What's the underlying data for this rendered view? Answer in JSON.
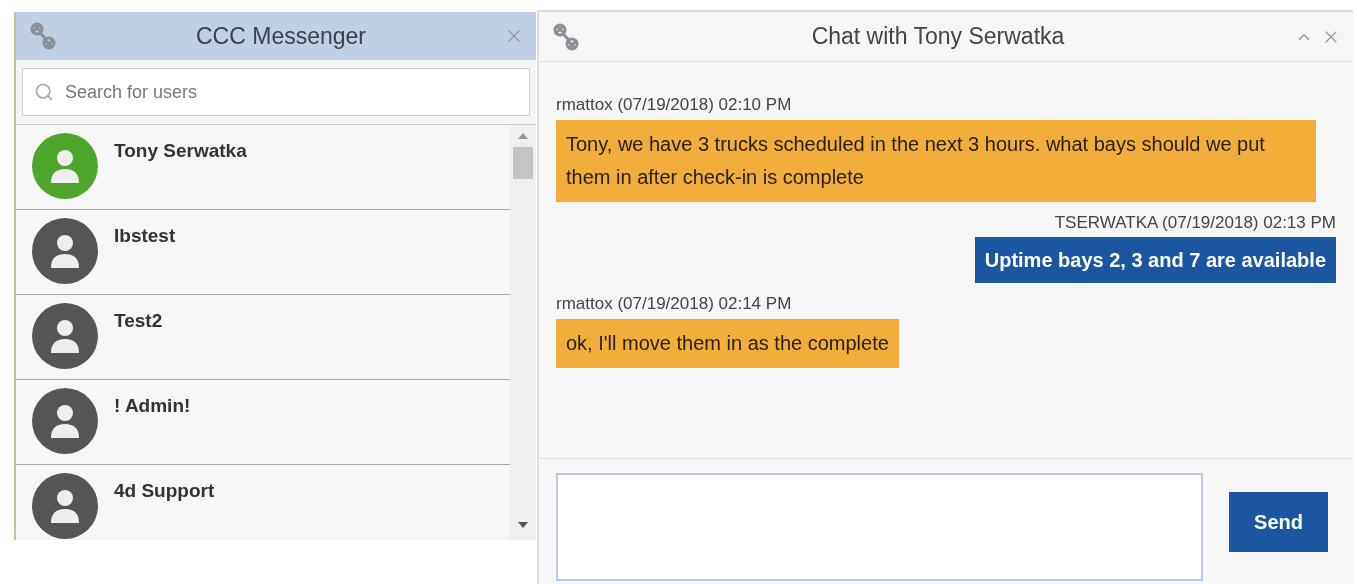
{
  "messenger": {
    "title": "CCC Messenger",
    "search": {
      "placeholder": "Search for users"
    },
    "contacts": [
      {
        "name": "Tony Serwatka",
        "online": true
      },
      {
        "name": "Ibstest",
        "online": false
      },
      {
        "name": "Test2",
        "online": false
      },
      {
        "name": "! Admin!",
        "online": false
      },
      {
        "name": "4d Support",
        "online": false
      }
    ]
  },
  "chat": {
    "title": "Chat with Tony Serwatka",
    "messages": [
      {
        "kind": "received",
        "meta": "rmattox (07/19/2018) 02:10 PM",
        "text": "Tony, we have 3 trucks scheduled in the next 3 hours. what bays should we put them in after check-in is complete"
      },
      {
        "kind": "sent",
        "meta": "TSERWATKA (07/19/2018) 02:13 PM",
        "text": "Uptime bays 2, 3 and 7 are available"
      },
      {
        "kind": "received",
        "meta": "rmattox (07/19/2018) 02:14 PM",
        "text": "ok, I'll move them in as the complete"
      }
    ],
    "send": "Send"
  }
}
